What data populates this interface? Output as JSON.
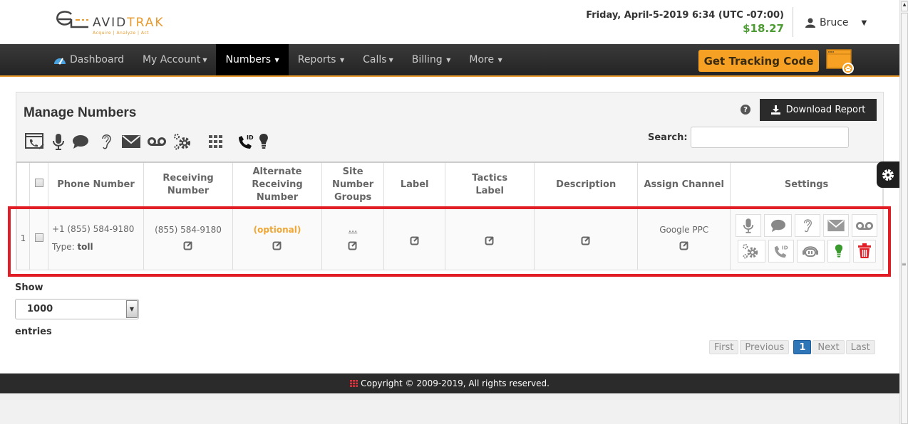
{
  "header": {
    "logo": {
      "brand_part1": "AVID",
      "brand_part2": "TRAK",
      "tagline": "Acquire  |  Analyze  |  Act"
    },
    "datetime": "Friday, April-5-2019 6:34 (UTC -07:00)",
    "balance": "$18.27",
    "user": {
      "name": "Bruce",
      "icon": "user-icon"
    }
  },
  "nav": {
    "items": [
      {
        "label": "Dashboard",
        "icon": "dashboard-icon",
        "dropdown": false,
        "active": false
      },
      {
        "label": "My Account",
        "dropdown": true,
        "active": false
      },
      {
        "label": "Numbers",
        "dropdown": true,
        "active": true
      },
      {
        "label": "Reports",
        "dropdown": true,
        "active": false
      },
      {
        "label": "Calls",
        "dropdown": true,
        "active": false
      },
      {
        "label": "Billing",
        "dropdown": true,
        "active": false
      },
      {
        "label": "More",
        "dropdown": true,
        "active": false
      }
    ],
    "tracking_button": "Get Tracking Code",
    "tracking_icon": "website-home-icon"
  },
  "panel": {
    "title": "Manage Numbers",
    "toolbar_icons": [
      "phone-edit-icon",
      "microphone-icon",
      "chat-icon",
      "ear-icon",
      "envelope-icon",
      "voicemail-icon",
      "gears-icon",
      "grid-icon",
      "caller-id-icon",
      "lightbulb-icon"
    ],
    "help_icon": "?",
    "download_button": "Download Report",
    "search_label": "Search:",
    "search_value": "",
    "search_placeholder": ""
  },
  "table": {
    "columns": [
      "",
      "",
      "Phone Number",
      "Receiving Number",
      "Alternate Receiving Number",
      "Site Number Groups",
      "Label",
      "Tactics Label",
      "Description",
      "Assign Channel",
      "Settings"
    ],
    "rows": [
      {
        "index": "1",
        "phone": "+1 (855) 584-9180",
        "type_label": "Type:",
        "type_value": "toll",
        "receiving": "(855) 584-9180",
        "alternate": "(optional)",
        "site_groups": "...",
        "label": "",
        "tactics_label": "",
        "description": "",
        "channel": "Google PPC",
        "settings_icons": [
          "microphone-icon",
          "chat-icon",
          "ear-icon",
          "envelope-icon",
          "voicemail-icon",
          "gears-icon",
          "caller-id-icon",
          "headset-bot-icon",
          "lightbulb-icon",
          "trash-icon"
        ]
      }
    ]
  },
  "length": {
    "show_label": "Show",
    "value": "1000",
    "entries_label": "entries"
  },
  "pagination": {
    "first": "First",
    "previous": "Previous",
    "current": "1",
    "next": "Next",
    "last": "Last"
  },
  "footer": {
    "text": "Copyright © 2009-2019, All rights reserved."
  },
  "colors": {
    "accent": "#f6a124",
    "nav_bg": "#2b2b2b",
    "highlight": "#e11d26",
    "balance": "#4c9a32",
    "pager_active": "#2f76b8"
  }
}
